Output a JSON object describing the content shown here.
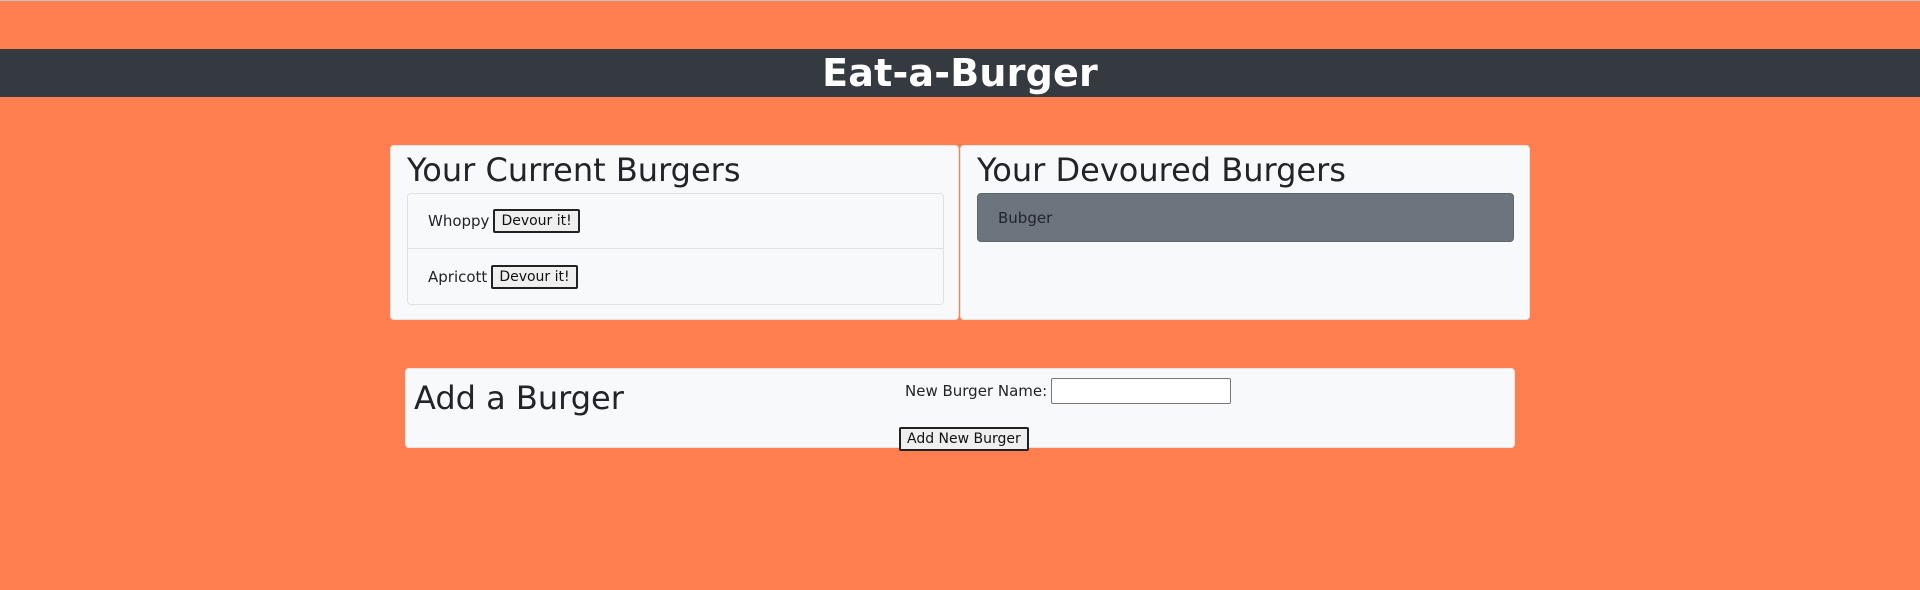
{
  "app": {
    "title": "Eat-a-Burger"
  },
  "current": {
    "heading": "Your Current Burgers",
    "items": [
      {
        "name": "Whoppy",
        "button_label": "Devour it!"
      },
      {
        "name": "Apricott",
        "button_label": "Devour it!"
      }
    ]
  },
  "devoured": {
    "heading": "Your Devoured Burgers",
    "items": [
      {
        "name": "Bubger"
      }
    ]
  },
  "add": {
    "heading": "Add a Burger",
    "input_label": "New Burger Name:",
    "input_value": "",
    "button_label": "Add New Burger"
  },
  "colors": {
    "background": "#ff7f50",
    "header": "#343a40",
    "card": "#f8f9fa",
    "devoured_item": "#6c757d"
  }
}
